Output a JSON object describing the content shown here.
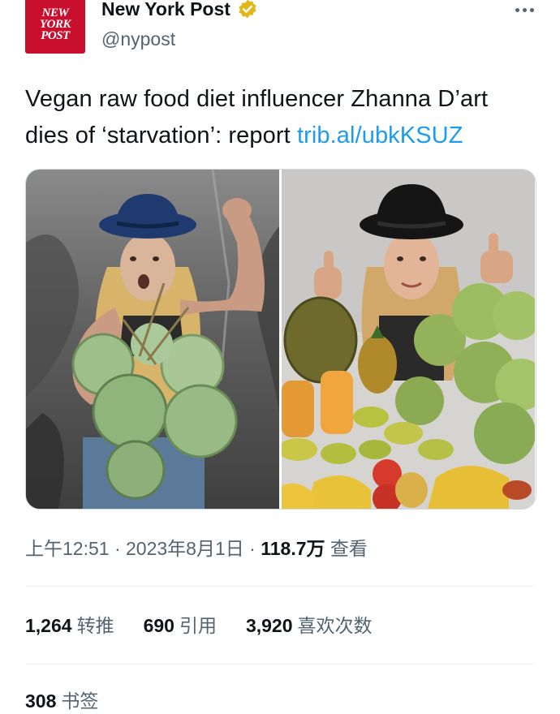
{
  "account": {
    "logo_line1": "NEW",
    "logo_line2": "YORK",
    "logo_line3": "POST",
    "name": "New York Post",
    "handle": "@nypost",
    "verified_icon": "gold-checkmark-badge",
    "colors": {
      "logo_bg": "#c8102e",
      "verified": "#e2b719"
    }
  },
  "tweet": {
    "text": "Vegan raw food diet influencer Zhanna D’art dies of ‘starvation’: report ",
    "link": "trib.al/ubkKSUZ",
    "link_color": "#1d9bf0"
  },
  "meta": {
    "time": "上午12:51",
    "sep1": " · ",
    "date": "2023年8月1日",
    "sep2": " · ",
    "views_count": "118.7万",
    "views_label": " 查看"
  },
  "stats": {
    "retweets_count": "1,264",
    "retweets_label": "转推",
    "quotes_count": "690",
    "quotes_label": "引用",
    "likes_count": "3,920",
    "likes_label": "喜欢次数",
    "bookmarks_count": "308",
    "bookmarks_label": "书签"
  }
}
